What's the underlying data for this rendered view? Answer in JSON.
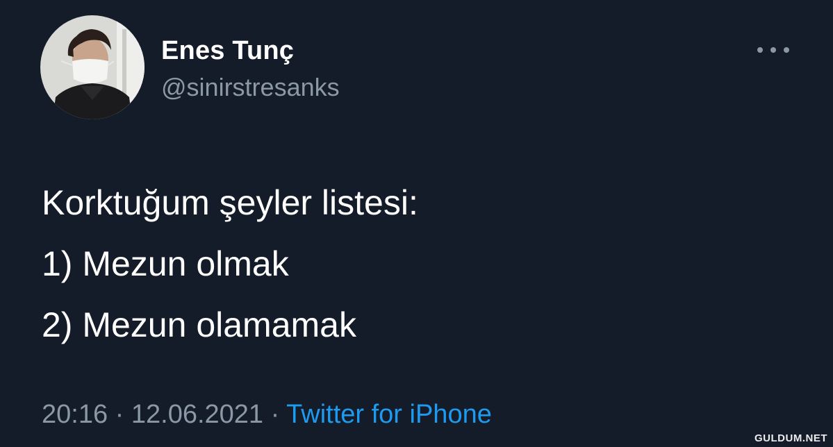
{
  "author": {
    "display_name": "Enes Tunç",
    "handle": "@sinirstresanks"
  },
  "more_icon": "more-horizontal-icon",
  "tweet": {
    "lines": [
      "Korktuğum şeyler listesi:",
      "1) Mezun olmak",
      "2) Mezun olamamak"
    ]
  },
  "meta": {
    "time": "20:16",
    "separator1": " · ",
    "date": "12.06.2021",
    "separator2": " · ",
    "source": "Twitter for iPhone"
  },
  "watermark": "GULDUM.NET",
  "colors": {
    "background": "#151c29",
    "primary_text": "#ffffff",
    "secondary_text": "#8b98a5",
    "link": "#1d9bf0"
  }
}
